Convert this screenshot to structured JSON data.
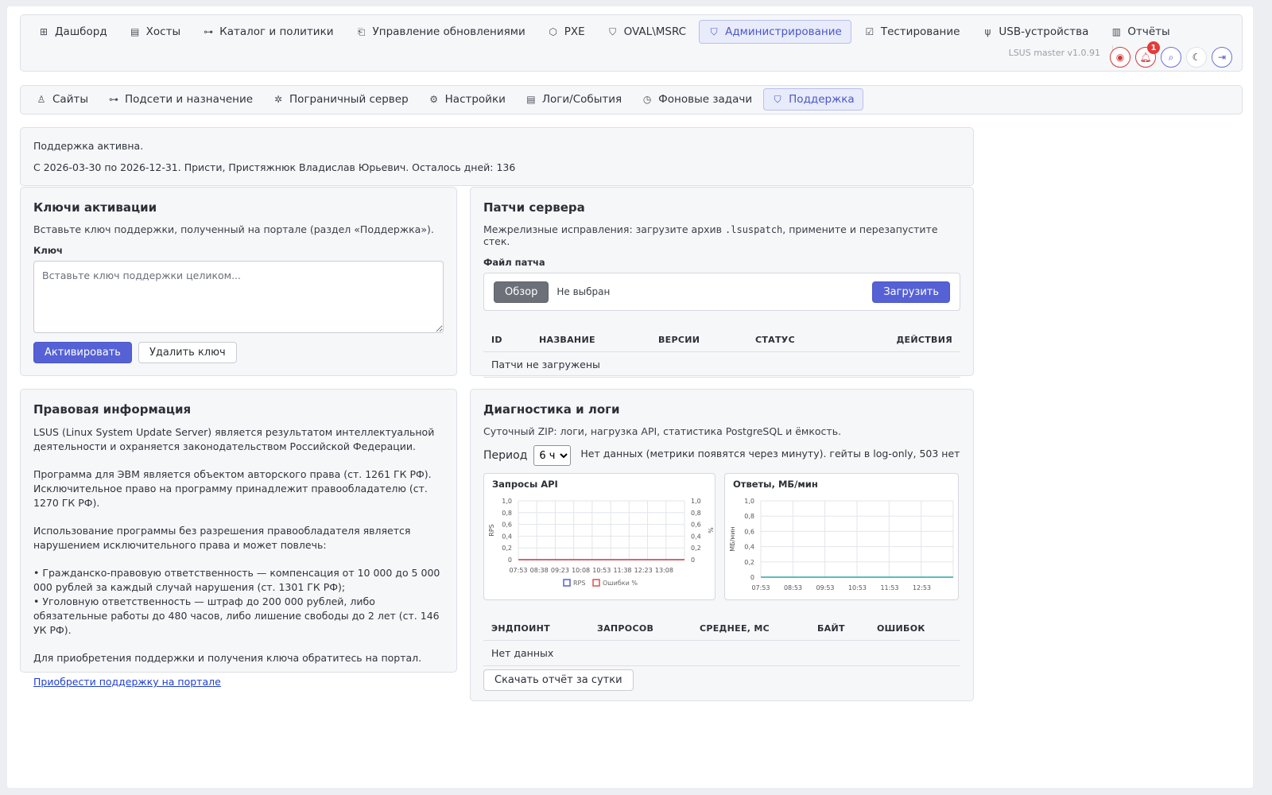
{
  "nav": {
    "tabs": [
      {
        "label": "Дашборд",
        "icon": "dashboard-icon",
        "glyph": "⊞"
      },
      {
        "label": "Хосты",
        "icon": "server-icon",
        "glyph": "▤"
      },
      {
        "label": "Каталог и политики",
        "icon": "hierarchy-icon",
        "glyph": "⊶"
      },
      {
        "label": "Управление обновлениями",
        "icon": "file-upload-icon",
        "glyph": "⎗"
      },
      {
        "label": "PXE",
        "icon": "box-icon",
        "glyph": "⬡"
      },
      {
        "label": "OVAL\\MSRC",
        "icon": "shield-icon",
        "glyph": "⛉"
      },
      {
        "label": "Администрирование",
        "icon": "shield-gear-icon",
        "glyph": "⛉"
      },
      {
        "label": "Тестирование",
        "icon": "checklist-icon",
        "glyph": "☑"
      },
      {
        "label": "USB-устройства",
        "icon": "usb-icon",
        "glyph": "ψ"
      },
      {
        "label": "Отчёты",
        "icon": "report-icon",
        "glyph": "▥"
      }
    ],
    "active": "Администрирование",
    "version": "LSUS master v1.0.91",
    "notifications_count": "1"
  },
  "subnav": {
    "tabs": [
      {
        "label": "Сайты",
        "icon": "sites-icon",
        "glyph": "♙"
      },
      {
        "label": "Подсети и назначение",
        "icon": "subnet-icon",
        "glyph": "⊶"
      },
      {
        "label": "Пограничный сервер",
        "icon": "edge-server-icon",
        "glyph": "✲"
      },
      {
        "label": "Настройки",
        "icon": "gear-icon",
        "glyph": "⚙"
      },
      {
        "label": "Логи/События",
        "icon": "log-icon",
        "glyph": "▤"
      },
      {
        "label": "Фоновые задачи",
        "icon": "clock-icon",
        "glyph": "◷"
      },
      {
        "label": "Поддержка",
        "icon": "shield-icon",
        "glyph": "⛉"
      }
    ],
    "active": "Поддержка"
  },
  "support_status": {
    "line1": "Поддержка активна.",
    "line2": "С 2026-03-30 по 2026-12-31. Присти, Пристяжнюк Владислав Юрьевич. Осталось дней: 136"
  },
  "keys": {
    "title": "Ключи активации",
    "description": "Вставьте ключ поддержки, полученный на портале (раздел «Поддержка»).",
    "key_label": "Ключ",
    "key_placeholder": "Вставьте ключ поддержки целиком...",
    "key_value": "",
    "activate_label": "Активировать",
    "delete_label": "Удалить ключ"
  },
  "patches": {
    "title": "Патчи сервера",
    "desc_before": "Межрелизные исправления: загрузите архив ",
    "desc_code": ".lsuspatch",
    "desc_after": ", примените и перезапустите стек.",
    "file_label": "Файл патча",
    "browse_label": "Обзор",
    "file_status": "Не выбран",
    "upload_label": "Загрузить",
    "columns": [
      "ID",
      "НАЗВАНИЕ",
      "ВЕРСИИ",
      "СТАТУС",
      "ДЕЙСТВИЯ"
    ],
    "empty_text": "Патчи не загружены"
  },
  "legal": {
    "title": "Правовая информация",
    "p1": "LSUS (Linux System Update Server) является результатом интеллектуальной деятельности и охраняется законодательством Российской Федерации.",
    "p2": "Программа для ЭВМ является объектом авторского права (ст. 1261 ГК РФ). Исключительное право на программу принадлежит правообладателю (ст. 1270 ГК РФ).",
    "p3": "Использование программы без разрешения правообладателя является нарушением исключительного права и может повлечь:",
    "p4a": "• Гражданско-правовую ответственность — компенсация от 10 000 до 5 000 000 рублей за каждый случай нарушения (ст. 1301 ГК РФ);",
    "p4b": "• Уголовную ответственность — штраф до 200 000 рублей, либо обязательные работы до 480 часов, либо лишение свободы до 2 лет (ст. 146 УК РФ).",
    "p5": "Для приобретения поддержки и получения ключа обратитесь на портал.",
    "link": "Приобрести поддержку на портале"
  },
  "diag": {
    "title": "Диагностика и логи",
    "description": "Суточный ZIP: логи, нагрузка API, статистика PostgreSQL и ёмкость.",
    "period_label": "Период",
    "period_value": "6 ч",
    "status_text": "Нет данных (метрики появятся через минуту). гейты в log-only, 503 нет",
    "columns": [
      "ЭНДПОИНТ",
      "ЗАПРОСОВ",
      "СРЕДНЕЕ, МС",
      "БАЙТ",
      "ОШИБОК"
    ],
    "empty_text": "Нет данных",
    "download_label": "Скачать отчёт за сутки"
  },
  "chart_data": [
    {
      "type": "line",
      "title": "Запросы API",
      "ylabel": "RPS",
      "y2label": "%",
      "x": [
        "07:53",
        "08:38",
        "09:23",
        "10:08",
        "10:53",
        "11:38",
        "12:23",
        "13:08"
      ],
      "yticks": [
        "0",
        "0,2",
        "0,4",
        "0,6",
        "0,8",
        "1,0"
      ],
      "ylim": [
        0,
        1
      ],
      "series": [
        {
          "name": "RPS",
          "values": [
            0,
            0,
            0,
            0,
            0,
            0,
            0,
            0
          ],
          "color": "#5561d4"
        },
        {
          "name": "Ошибки %",
          "values": [
            0,
            0,
            0,
            0,
            0,
            0,
            0,
            0
          ],
          "color": "#d9534f"
        }
      ],
      "legend": "bottom",
      "grid": true
    },
    {
      "type": "line",
      "title": "Ответы, МБ/мин",
      "ylabel": "МБ/мин",
      "x": [
        "07:53",
        "08:53",
        "09:53",
        "10:53",
        "11:53",
        "12:53"
      ],
      "yticks": [
        "0",
        "0,2",
        "0,4",
        "0,6",
        "0,8",
        "1,0"
      ],
      "ylim": [
        0,
        1
      ],
      "series": [
        {
          "values": [
            0,
            0,
            0,
            0,
            0,
            0,
            0
          ],
          "color": "#2aa7a0"
        }
      ],
      "grid": true
    }
  ]
}
